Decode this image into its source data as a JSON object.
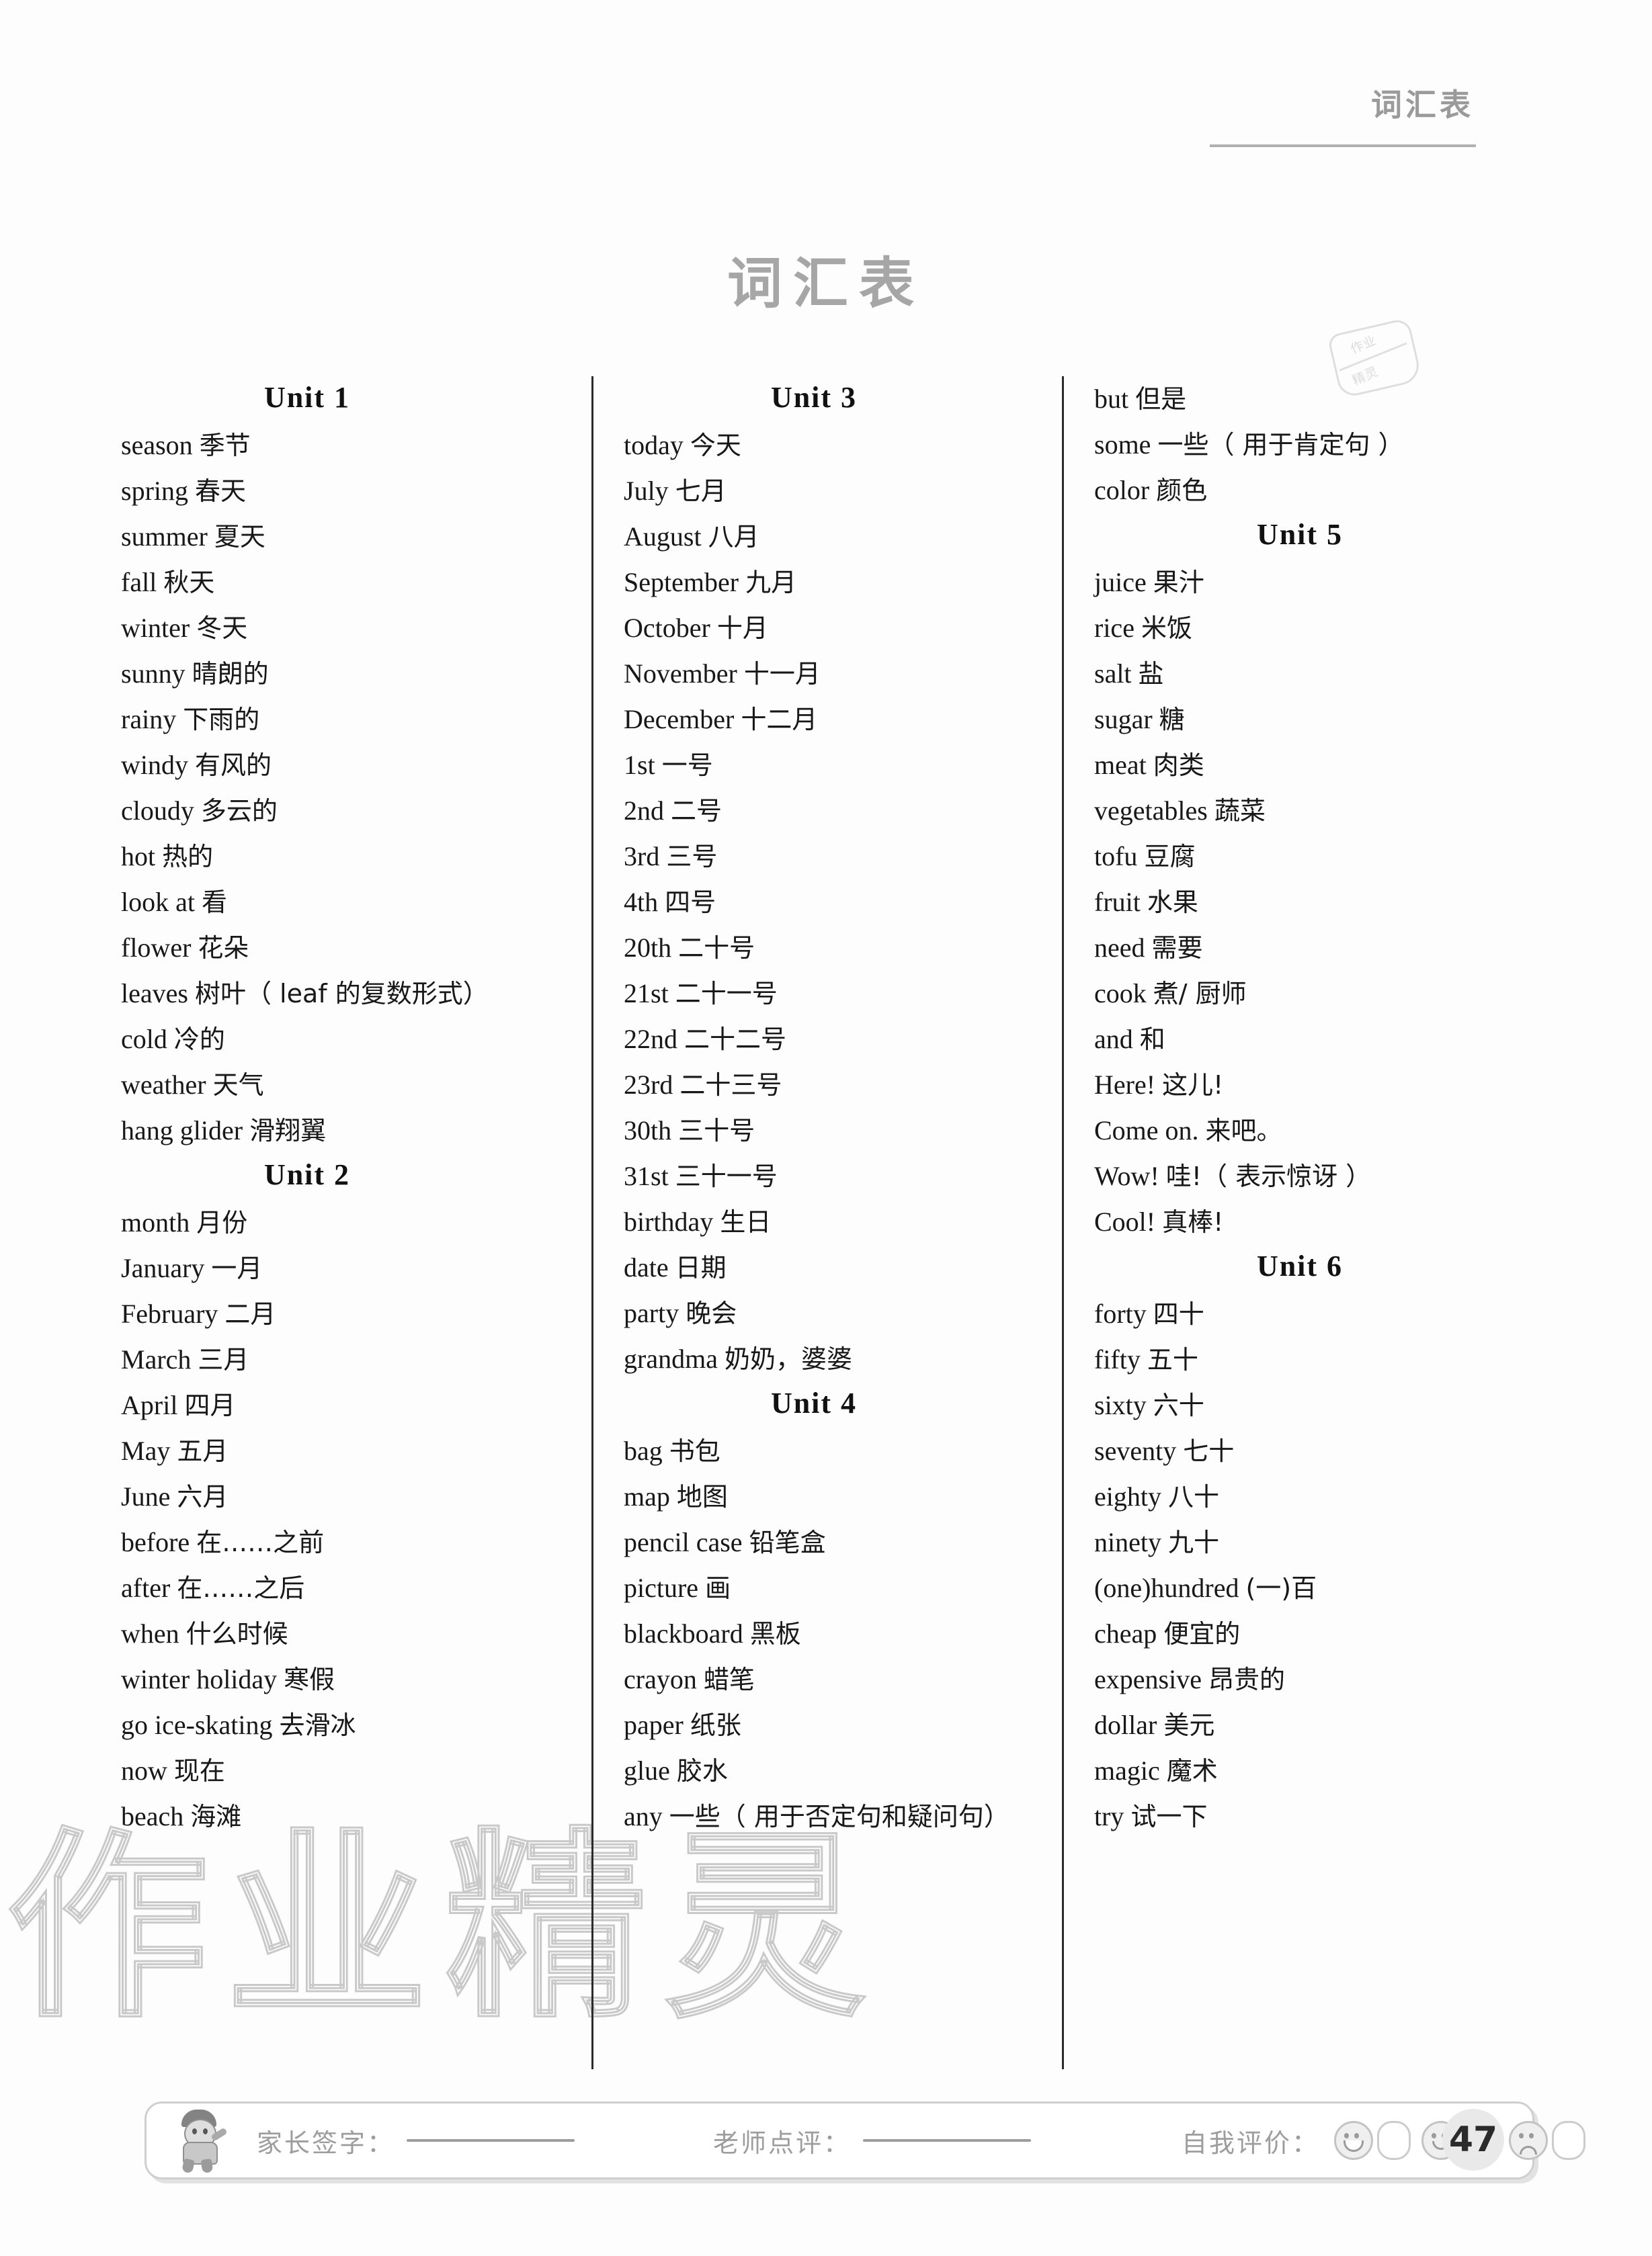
{
  "running_header": {
    "title": "词汇表"
  },
  "page_title": "词汇表",
  "stamp_badge": {
    "line1": "作业",
    "line2": "精灵"
  },
  "watermark": {
    "text": "作业精灵"
  },
  "columns": [
    {
      "id": "column-1",
      "sections": [
        {
          "unit": "Unit 1",
          "entries": [
            {
              "en": "season",
              "cn": "季节"
            },
            {
              "en": "spring",
              "cn": "春天"
            },
            {
              "en": "summer",
              "cn": "夏天"
            },
            {
              "en": "fall",
              "cn": "秋天"
            },
            {
              "en": "winter",
              "cn": "冬天"
            },
            {
              "en": "sunny",
              "cn": "晴朗的"
            },
            {
              "en": "rainy",
              "cn": "下雨的"
            },
            {
              "en": "windy",
              "cn": "有风的"
            },
            {
              "en": "cloudy",
              "cn": "多云的"
            },
            {
              "en": "hot",
              "cn": "热的"
            },
            {
              "en": "look at",
              "cn": "看"
            },
            {
              "en": "flower",
              "cn": "花朵"
            },
            {
              "en": "leaves",
              "cn": "树叶（ leaf 的复数形式）"
            },
            {
              "en": "cold",
              "cn": "冷的"
            },
            {
              "en": "weather",
              "cn": "天气"
            },
            {
              "en": "hang glider",
              "cn": "滑翔翼"
            }
          ]
        },
        {
          "unit": "Unit 2",
          "entries": [
            {
              "en": "month",
              "cn": "月份"
            },
            {
              "en": "January",
              "cn": "一月"
            },
            {
              "en": "February",
              "cn": "二月"
            },
            {
              "en": "March",
              "cn": "三月"
            },
            {
              "en": "April",
              "cn": "四月"
            },
            {
              "en": "May",
              "cn": "五月"
            },
            {
              "en": "June",
              "cn": "六月"
            },
            {
              "en": "before",
              "cn": "在……之前"
            },
            {
              "en": "after",
              "cn": "在……之后"
            },
            {
              "en": "when",
              "cn": "什么时候"
            },
            {
              "en": "winter holiday",
              "cn": "寒假"
            },
            {
              "en": "go ice-skating",
              "cn": "去滑冰"
            },
            {
              "en": "now",
              "cn": "现在"
            },
            {
              "en": "beach",
              "cn": "海滩"
            }
          ]
        }
      ]
    },
    {
      "id": "column-2",
      "sections": [
        {
          "unit": "Unit 3",
          "entries": [
            {
              "en": "today",
              "cn": "今天"
            },
            {
              "en": "July",
              "cn": "七月"
            },
            {
              "en": "August",
              "cn": "八月"
            },
            {
              "en": "September",
              "cn": "九月"
            },
            {
              "en": "October",
              "cn": "十月"
            },
            {
              "en": "November",
              "cn": "十一月"
            },
            {
              "en": "December",
              "cn": "十二月"
            },
            {
              "en": "1st",
              "cn": "一号"
            },
            {
              "en": "2nd",
              "cn": "二号"
            },
            {
              "en": "3rd",
              "cn": "三号"
            },
            {
              "en": "4th",
              "cn": "四号"
            },
            {
              "en": "20th",
              "cn": "二十号"
            },
            {
              "en": "21st",
              "cn": "二十一号"
            },
            {
              "en": "22nd",
              "cn": "二十二号"
            },
            {
              "en": "23rd",
              "cn": "二十三号"
            },
            {
              "en": "30th",
              "cn": "三十号"
            },
            {
              "en": "31st",
              "cn": "三十一号"
            },
            {
              "en": "birthday",
              "cn": "生日"
            },
            {
              "en": "date",
              "cn": "日期"
            },
            {
              "en": "party",
              "cn": "晚会"
            },
            {
              "en": "grandma",
              "cn": "奶奶，婆婆"
            }
          ]
        },
        {
          "unit": "Unit 4",
          "entries": [
            {
              "en": "bag",
              "cn": "书包"
            },
            {
              "en": "map",
              "cn": "地图"
            },
            {
              "en": "pencil case",
              "cn": "铅笔盒"
            },
            {
              "en": "picture",
              "cn": "画"
            },
            {
              "en": "blackboard",
              "cn": "黑板"
            },
            {
              "en": "crayon",
              "cn": "蜡笔"
            },
            {
              "en": "paper",
              "cn": "纸张"
            },
            {
              "en": "glue",
              "cn": "胶水"
            },
            {
              "en": "any",
              "cn": "一些（ 用于否定句和疑问句）"
            }
          ]
        }
      ]
    },
    {
      "id": "column-3",
      "sections": [
        {
          "unit": null,
          "entries": [
            {
              "en": "but",
              "cn": "但是"
            },
            {
              "en": "some",
              "cn": "一些（ 用于肯定句 ）"
            },
            {
              "en": "color",
              "cn": "颜色"
            }
          ]
        },
        {
          "unit": "Unit 5",
          "entries": [
            {
              "en": "juice",
              "cn": "果汁"
            },
            {
              "en": "rice",
              "cn": "米饭"
            },
            {
              "en": "salt",
              "cn": "盐"
            },
            {
              "en": "sugar",
              "cn": "糖"
            },
            {
              "en": "meat",
              "cn": "肉类"
            },
            {
              "en": "vegetables",
              "cn": "蔬菜"
            },
            {
              "en": "tofu",
              "cn": "豆腐"
            },
            {
              "en": "fruit",
              "cn": "水果"
            },
            {
              "en": "need",
              "cn": "需要"
            },
            {
              "en": "cook",
              "cn": "煮/ 厨师"
            },
            {
              "en": "and",
              "cn": "和"
            },
            {
              "en": "Here!",
              "cn": "这儿!"
            },
            {
              "en": "Come on.",
              "cn": "来吧。"
            },
            {
              "en": "Wow!",
              "cn": "哇!（ 表示惊讶 ）"
            },
            {
              "en": "Cool!",
              "cn": "真棒!"
            }
          ]
        },
        {
          "unit": "Unit 6",
          "entries": [
            {
              "en": "forty",
              "cn": "四十"
            },
            {
              "en": "fifty",
              "cn": "五十"
            },
            {
              "en": "sixty",
              "cn": "六十"
            },
            {
              "en": "seventy",
              "cn": "七十"
            },
            {
              "en": "eighty",
              "cn": "八十"
            },
            {
              "en": "ninety",
              "cn": "九十"
            },
            {
              "en": "(one)hundred",
              "cn": "(一)百"
            },
            {
              "en": "cheap",
              "cn": "便宜的"
            },
            {
              "en": "expensive",
              "cn": "昂贵的"
            },
            {
              "en": "dollar",
              "cn": "美元"
            },
            {
              "en": "magic",
              "cn": "魔术"
            },
            {
              "en": "try",
              "cn": "试一下"
            }
          ]
        }
      ]
    }
  ],
  "footer": {
    "parent_label": "家长签字：",
    "teacher_label": "老师点评：",
    "self_label": "自我评价：",
    "faces": [
      "laugh",
      "smile",
      "sad"
    ],
    "page_number": "47"
  }
}
